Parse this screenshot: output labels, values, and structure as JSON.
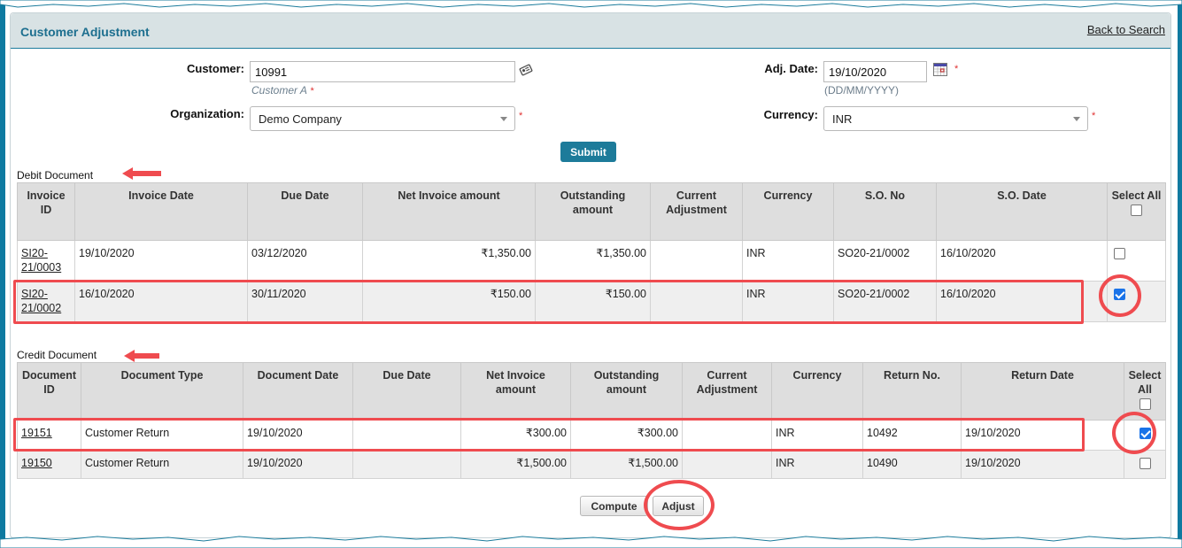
{
  "header": {
    "title": "Customer Adjustment",
    "back_link": "Back to Search"
  },
  "form": {
    "customer_label": "Customer:",
    "customer_value": "10991",
    "customer_name": "Customer A",
    "required_mark": "*",
    "organization_label": "Organization:",
    "organization_value": "Demo Company",
    "adj_date_label": "Adj. Date:",
    "adj_date_value": "19/10/2020",
    "date_format_hint": "(DD/MM/YYYY)",
    "currency_label": "Currency:",
    "currency_value": "INR",
    "submit_label": "Submit",
    "icons": {
      "customer_lookup": "address-card-icon",
      "date_picker": "calendar-icon",
      "dropdown": "chevron-down-icon"
    }
  },
  "debit": {
    "section_label": "Debit Document",
    "columns": [
      "Invoice ID",
      "Invoice Date",
      "Due Date",
      "Net Invoice amount",
      "Outstanding amount",
      "Current Adjustment",
      "Currency",
      "S.O. No",
      "S.O. Date",
      "Select All"
    ],
    "rows": [
      {
        "invoice_id": "SI20-21/0003",
        "invoice_date": "19/10/2020",
        "due_date": "03/12/2020",
        "net_amount": "₹1,350.00",
        "outstanding": "₹1,350.00",
        "current_adjustment": "",
        "currency": "INR",
        "so_no": "SO20-21/0002",
        "so_date": "16/10/2020",
        "selected": false
      },
      {
        "invoice_id": "SI20-21/0002",
        "invoice_date": "16/10/2020",
        "due_date": "30/11/2020",
        "net_amount": "₹150.00",
        "outstanding": "₹150.00",
        "current_adjustment": "",
        "currency": "INR",
        "so_no": "SO20-21/0002",
        "so_date": "16/10/2020",
        "selected": true
      }
    ]
  },
  "credit": {
    "section_label": "Credit Document",
    "columns": [
      "Document ID",
      "Document Type",
      "Document Date",
      "Due Date",
      "Net Invoice amount",
      "Outstanding amount",
      "Current Adjustment",
      "Currency",
      "Return No.",
      "Return Date",
      "Select All"
    ],
    "rows": [
      {
        "document_id": "19151",
        "document_type": "Customer Return",
        "document_date": "19/10/2020",
        "due_date": "",
        "net_amount": "₹300.00",
        "outstanding": "₹300.00",
        "current_adjustment": "",
        "currency": "INR",
        "return_no": "10492",
        "return_date": "19/10/2020",
        "selected": true
      },
      {
        "document_id": "19150",
        "document_type": "Customer Return",
        "document_date": "19/10/2020",
        "due_date": "",
        "net_amount": "₹1,500.00",
        "outstanding": "₹1,500.00",
        "current_adjustment": "",
        "currency": "INR",
        "return_no": "10490",
        "return_date": "19/10/2020",
        "selected": false
      }
    ]
  },
  "actions": {
    "compute_label": "Compute",
    "adjust_label": "Adjust"
  },
  "colors": {
    "accent": "#1d7b9a",
    "header_bg": "#d8e2e4",
    "annotation": "#ef4b4f",
    "checkbox_checked": "#1a73e8"
  }
}
